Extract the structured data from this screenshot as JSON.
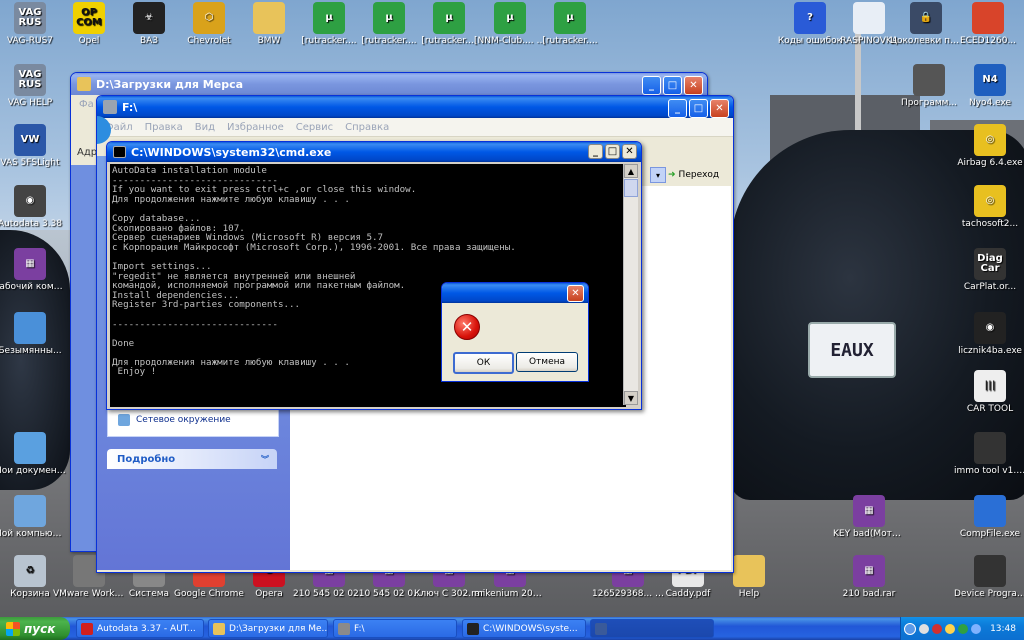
{
  "desktop_icons": [
    {
      "label": "VAG-RUS7",
      "icon": "vag-logo-icon",
      "color": "#7a8aa0",
      "text": "VAG RUS"
    },
    {
      "label": "Opel",
      "icon": "opcom-icon",
      "color": "#f0d000",
      "text": "OP COM"
    },
    {
      "label": "ВАЗ",
      "icon": "biohazard-icon",
      "color": "#222222",
      "text": "☣"
    },
    {
      "label": "Chevrolet",
      "icon": "chevrolet-icon",
      "color": "#d9a21b",
      "text": "⬡"
    },
    {
      "label": "BMW",
      "icon": "folder-icon",
      "color": "#e8c35a",
      "text": ""
    },
    {
      "label": "[rutracker....",
      "icon": "utorrent-icon",
      "color": "#2ea043",
      "text": "µ"
    },
    {
      "label": "[rutracker....",
      "icon": "utorrent-icon",
      "color": "#2ea043",
      "text": "µ"
    },
    {
      "label": "[rutracker....",
      "icon": "utorrent-icon",
      "color": "#2ea043",
      "text": "µ"
    },
    {
      "label": "[NNM-Club.... SP3 ENG.to...",
      "icon": "utorrent-icon",
      "color": "#2ea043",
      "text": "µ"
    },
    {
      "label": "[rutracker....",
      "icon": "utorrent-icon",
      "color": "#2ea043",
      "text": "µ"
    },
    {
      "label": "Коды ошибок",
      "icon": "help-icon",
      "color": "#2a5bd7",
      "text": "?"
    },
    {
      "label": "RASPINOVKA",
      "icon": "document-icon",
      "color": "#e8eef6",
      "text": ""
    },
    {
      "label": "Цоколевки проводов д...",
      "icon": "lock-icon",
      "color": "#3a4a66",
      "text": "🔒"
    },
    {
      "label": "ECED1260...",
      "icon": "app-icon",
      "color": "#d8442a",
      "text": ""
    },
    {
      "label": "VAG HELP",
      "icon": "vag-logo-icon",
      "color": "#7a8aa0",
      "text": "VAG RUS"
    },
    {
      "label": "Программ...",
      "icon": "chip-icon",
      "color": "#555555",
      "text": ""
    },
    {
      "label": "Nyo4.exe",
      "icon": "n4-icon",
      "color": "#1f5fbf",
      "text": "N4"
    },
    {
      "label": "VAS 5FSLight",
      "icon": "vw-icon",
      "color": "#2b57a8",
      "text": "VW"
    },
    {
      "label": "Airbag 6.4.exe",
      "icon": "target-icon",
      "color": "#e8c020",
      "text": "◎"
    },
    {
      "label": "Autodata 3.38",
      "icon": "disc-icon",
      "color": "#444444",
      "text": "◉"
    },
    {
      "label": "tachosoft2...",
      "icon": "target-icon",
      "color": "#e8c020",
      "text": "◎"
    },
    {
      "label": "Рабочий компле...",
      "icon": "winrar-icon",
      "color": "#7b3fa0",
      "text": "▦"
    },
    {
      "label": "CarPlat.or...",
      "icon": "diag-car-icon",
      "color": "#333333",
      "text": "Diag Car"
    },
    {
      "label": "Безымянны...",
      "icon": "image-icon",
      "color": "#4a90d9",
      "text": ""
    },
    {
      "label": "licznik4ba.exe",
      "icon": "disc-icon",
      "color": "#222222",
      "text": "◉"
    },
    {
      "label": "CAR TOOL",
      "icon": "barcode-icon",
      "color": "#eeeeee",
      "text": "|||"
    },
    {
      "label": "Мои документы",
      "icon": "my-documents-icon",
      "color": "#5aa0e0",
      "text": ""
    },
    {
      "label": "immo tool v1.1 cracked.exe",
      "icon": "chip-icon",
      "color": "#333333",
      "text": ""
    },
    {
      "label": "Мой компьютер",
      "icon": "my-computer-icon",
      "color": "#6fa6de",
      "text": ""
    },
    {
      "label": "KEY bad(Мотор...",
      "icon": "winrar-icon",
      "color": "#7b3fa0",
      "text": "▦"
    },
    {
      "label": "CompFile.exe",
      "icon": "app-icon",
      "color": "#2a6fd6",
      "text": ""
    },
    {
      "label": "Корзина",
      "icon": "recycle-bin-icon",
      "color": "#b8c4d0",
      "text": "♻"
    },
    {
      "label": "VMware Workstation",
      "icon": "vmware-icon",
      "color": "#777777",
      "text": ""
    },
    {
      "label": "Система",
      "icon": "system-icon",
      "color": "#888888",
      "text": ""
    },
    {
      "label": "Google Chrome",
      "icon": "chrome-icon",
      "color": "#e04030",
      "text": ""
    },
    {
      "label": "Opera",
      "icon": "opera-icon",
      "color": "#cc1020",
      "text": "O"
    },
    {
      "label": "210 545 02 08 QB_1589....",
      "icon": "winrar-icon",
      "color": "#7b3fa0",
      "text": "▦"
    },
    {
      "label": "210 545 02 08 QB_1589.rar",
      "icon": "winrar-icon",
      "color": "#7b3fa0",
      "text": "▦"
    },
    {
      "label": "Ключ С 302.rar",
      "icon": "winrar-icon",
      "color": "#7b3fa0",
      "text": "▦"
    },
    {
      "label": "mikenium 2010.rar",
      "icon": "winrar-icon",
      "color": "#7b3fa0",
      "text": "▦"
    },
    {
      "label": "126529368... Restorer.E...",
      "icon": "winrar-icon",
      "color": "#7b3fa0",
      "text": "▦"
    },
    {
      "label": "Caddy.pdf",
      "icon": "pdf-icon",
      "color": "#e8e8e8",
      "text": "PDF"
    },
    {
      "label": "Help",
      "icon": "folder-icon",
      "color": "#e8c35a",
      "text": ""
    },
    {
      "label": "210 bad.rar",
      "icon": "winrar-icon",
      "color": "#7b3fa0",
      "text": "▦"
    },
    {
      "label": "Device Program...",
      "icon": "chip-icon",
      "color": "#333333",
      "text": ""
    }
  ],
  "background": {
    "plate_text": "EAUX"
  },
  "explorer_back": {
    "title": "D:\\Загрузки  для Мерса",
    "menu_first": "Фа",
    "address_label": "Адр"
  },
  "explorer_front": {
    "title": "F:\\",
    "menu": [
      "Файл",
      "Правка",
      "Вид",
      "Избранное",
      "Сервис",
      "Справка"
    ],
    "go_button": "Переход",
    "network_label": "Сетевое окружение",
    "details_label": "Подробно"
  },
  "cmd": {
    "title": "C:\\WINDOWS\\system32\\cmd.exe",
    "lines": [
      "AutoData installation module",
      "------------------------------",
      "If you want to exit press ctrl+c ,or close this window.",
      "Для продолжения нажмите любую клавишу . . .",
      "",
      "Copy database...",
      "Скопировано файлов: 107.",
      "Сервер сценариев Windows (Microsoft R) версия 5.7",
      "с Корпорация Майкрософт (Microsoft Corp.), 1996-2001. Все права защищены.",
      "",
      "Import settings...",
      "\"regedit\" не является внутренней или внешней",
      "командой, исполняемой программой или пакетным файлом.",
      "Install dependencies...",
      "Register 3rd-parties components...",
      "",
      "------------------------------",
      "",
      "Done",
      "",
      "Для продолжения нажмите любую клавишу . . .",
      " Enjoy !"
    ]
  },
  "dialog": {
    "ok": "ОК",
    "cancel": "Отмена"
  },
  "taskbar": {
    "start": "пуск",
    "tasks": [
      {
        "label": "Autodata 3.37 - AUT...",
        "icon_color": "#d02020"
      },
      {
        "label": "D:\\Загрузки  для Ме...",
        "icon_color": "#e8c35a"
      },
      {
        "label": "F:\\",
        "icon_color": "#8a8a8a"
      },
      {
        "label": "C:\\WINDOWS\\syste...",
        "icon_color": "#222222"
      },
      {
        "label": "",
        "icon_color": "#3a5a9a"
      }
    ],
    "clock": "13:48"
  }
}
